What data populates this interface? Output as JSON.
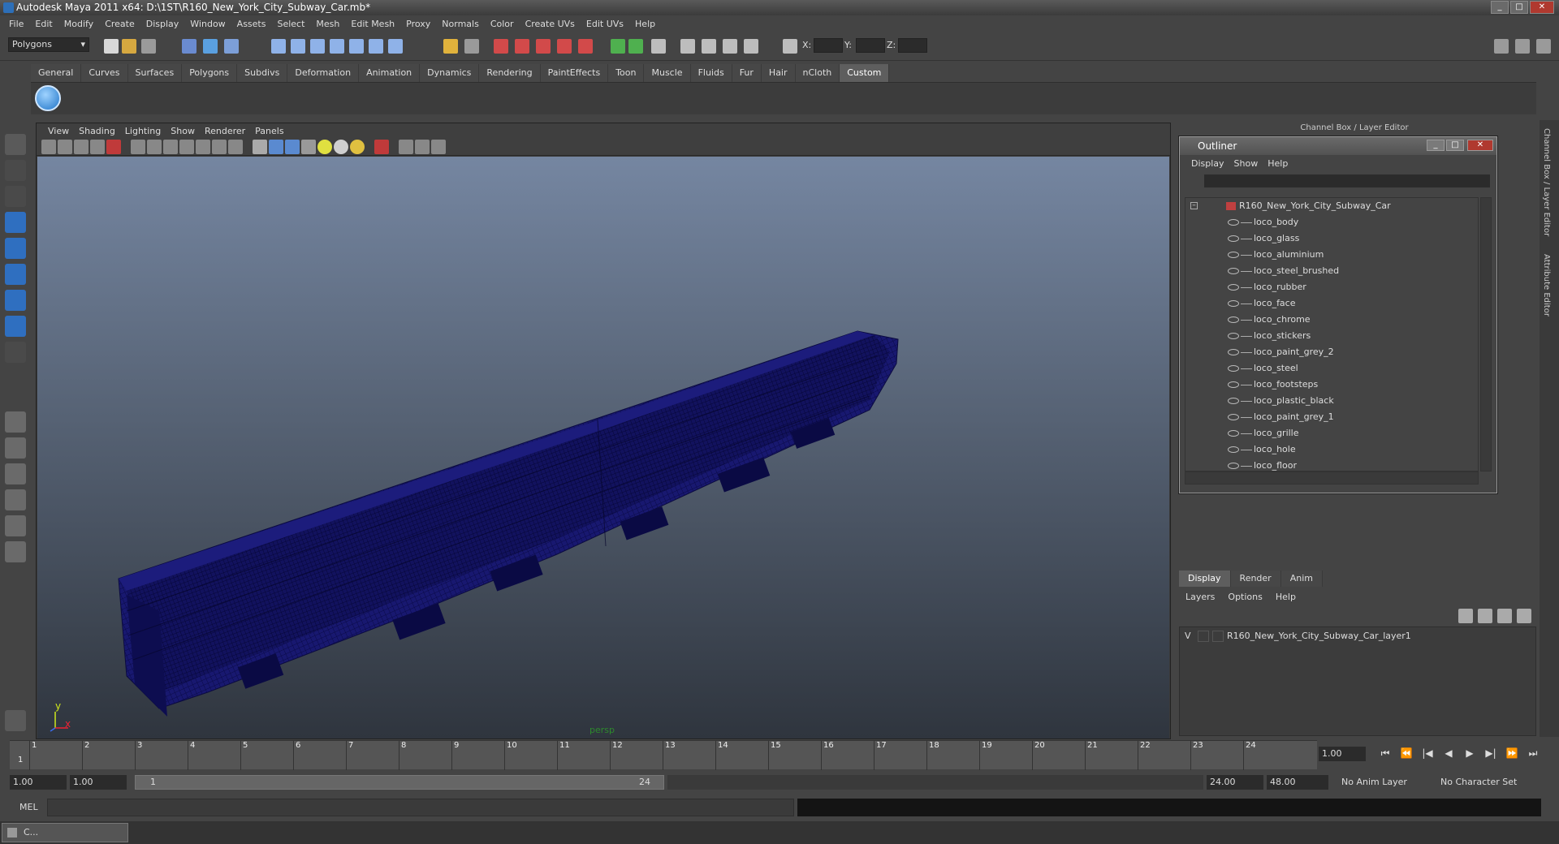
{
  "window": {
    "title": "Autodesk Maya 2011 x64: D:\\1ST\\R160_New_York_City_Subway_Car.mb*",
    "buttons": {
      "min": "_",
      "max": "□",
      "close": "✕"
    }
  },
  "menubar": [
    "File",
    "Edit",
    "Modify",
    "Create",
    "Display",
    "Window",
    "Assets",
    "Select",
    "Mesh",
    "Edit Mesh",
    "Proxy",
    "Normals",
    "Color",
    "Create UVs",
    "Edit UVs",
    "Help"
  ],
  "toolbar": {
    "mode": "Polygons",
    "coord_labels": {
      "x": "X:",
      "y": "Y:",
      "z": "Z:"
    }
  },
  "shelf": {
    "tabs": [
      "General",
      "Curves",
      "Surfaces",
      "Polygons",
      "Subdivs",
      "Deformation",
      "Animation",
      "Dynamics",
      "Rendering",
      "PaintEffects",
      "Toon",
      "Muscle",
      "Fluids",
      "Fur",
      "Hair",
      "nCloth",
      "Custom"
    ],
    "active_tab": "Custom"
  },
  "viewport": {
    "menu": [
      "View",
      "Shading",
      "Lighting",
      "Show",
      "Renderer",
      "Panels"
    ],
    "camera_label": "persp",
    "axis": {
      "y": "y",
      "x": "x",
      "z": "z"
    },
    "wire_color": "#141474"
  },
  "right_panel": {
    "title": "Channel Box / Layer Editor",
    "side_tabs": [
      "Channel Box / Layer Editor",
      "Attribute Editor"
    ]
  },
  "outliner": {
    "title": "Outliner",
    "menu": [
      "Display",
      "Show",
      "Help"
    ],
    "root": "R160_New_York_City_Subway_Car",
    "children": [
      "loco_body",
      "loco_glass",
      "loco_aluminium",
      "loco_steel_brushed",
      "loco_rubber",
      "loco_face",
      "loco_chrome",
      "loco_stickers",
      "loco_paint_grey_2",
      "loco_steel",
      "loco_footsteps",
      "loco_plastic_black",
      "loco_paint_grey_1",
      "loco_grille",
      "loco_hole",
      "loco_floor"
    ]
  },
  "layer_editor": {
    "tabs": [
      "Display",
      "Render",
      "Anim"
    ],
    "active_tab": "Display",
    "menu": [
      "Layers",
      "Options",
      "Help"
    ],
    "layer": {
      "visible": "V",
      "name": "R160_New_York_City_Subway_Car_layer1"
    }
  },
  "timeline": {
    "frames": [
      "1",
      "2",
      "3",
      "4",
      "5",
      "6",
      "7",
      "8",
      "9",
      "10",
      "11",
      "12",
      "13",
      "14",
      "15",
      "16",
      "17",
      "18",
      "19",
      "20",
      "21",
      "22",
      "23",
      "24"
    ],
    "current_frame_marker": "1",
    "current_time": "1.00",
    "play_controls": [
      "⏮",
      "⏪",
      "|◀",
      "◀",
      "▶",
      "▶|",
      "⏩",
      "⏭"
    ]
  },
  "range": {
    "start": "1.00",
    "playback_start": "1.00",
    "slider_start": "1",
    "slider_end": "24",
    "playback_end": "24.00",
    "end": "48.00",
    "anim_layer": "No Anim Layer",
    "char_set": "No Character Set"
  },
  "command_line": {
    "label": "MEL"
  },
  "taskbar": {
    "item": "C..."
  }
}
